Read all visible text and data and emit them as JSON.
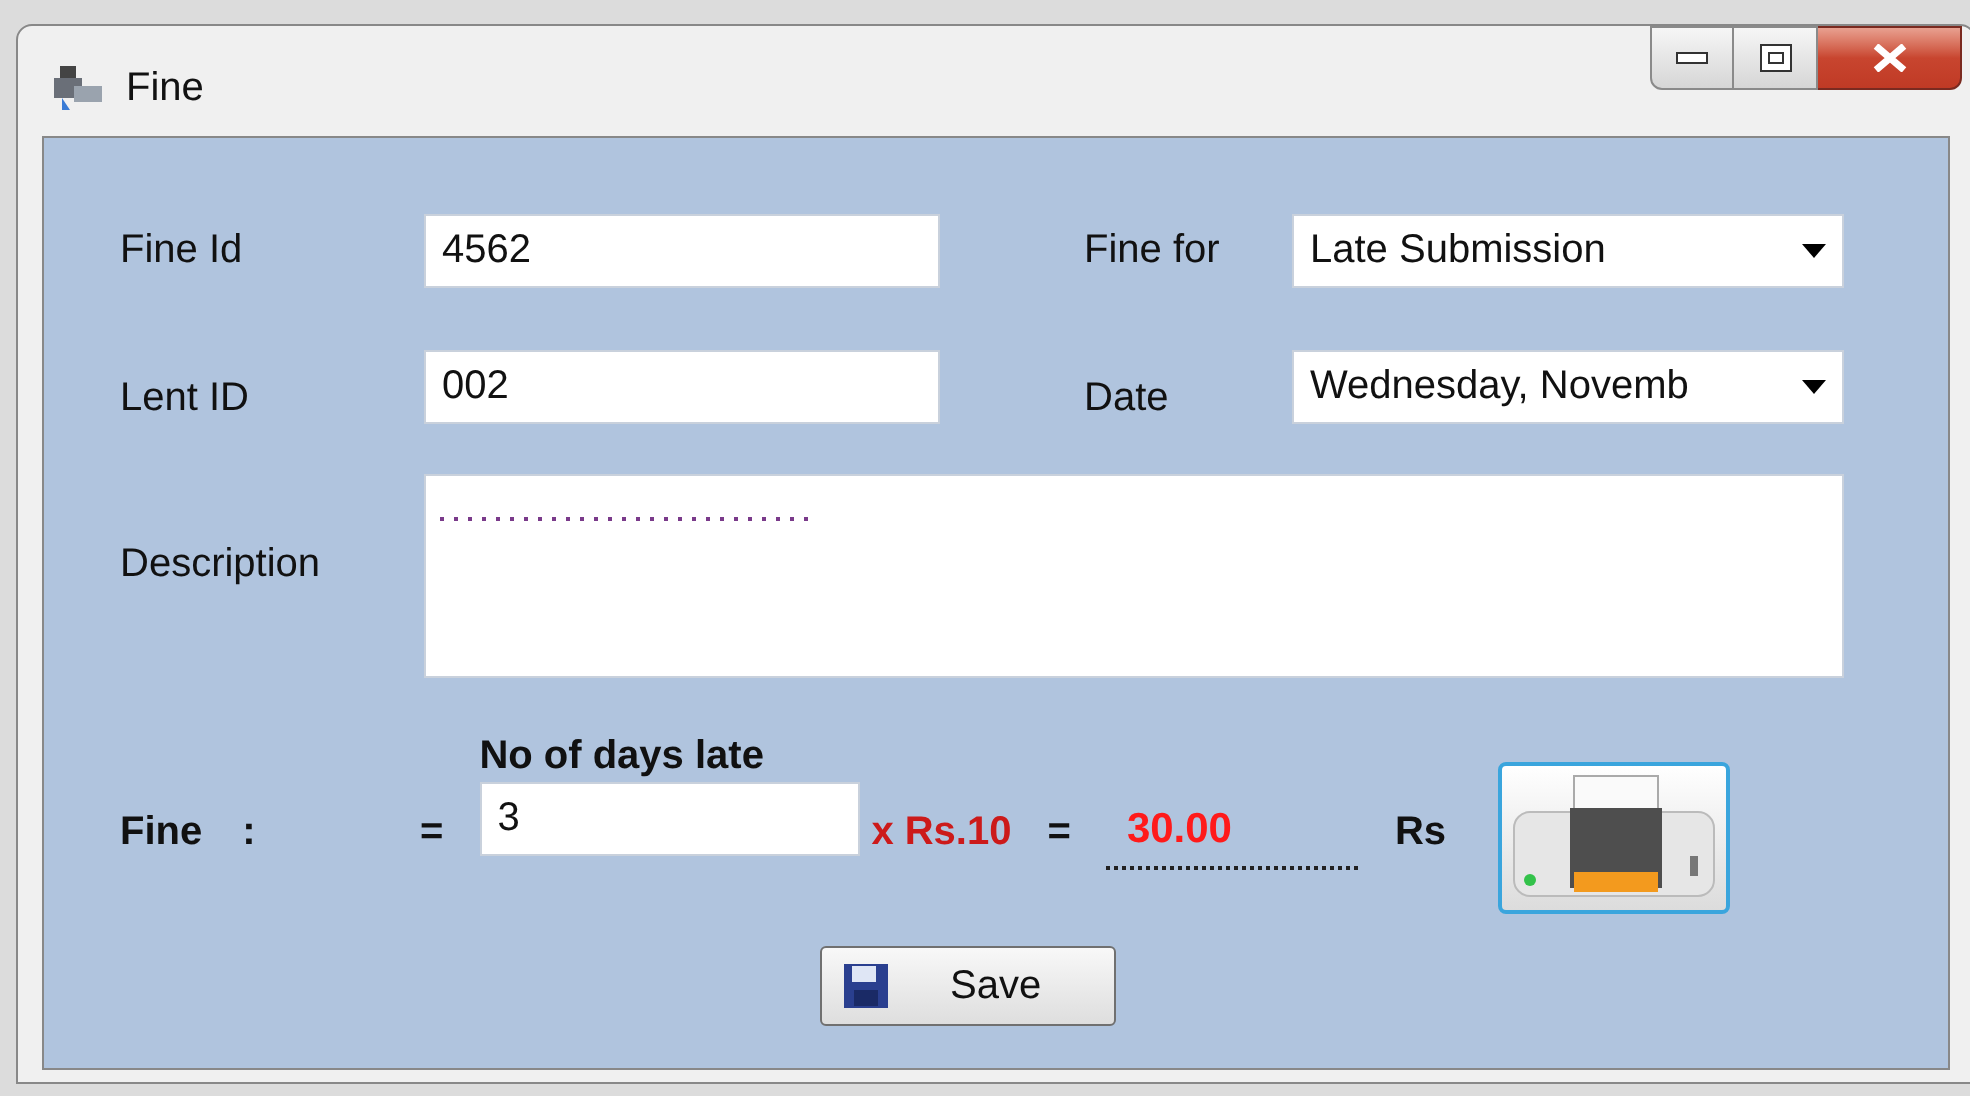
{
  "window": {
    "title": "Fine"
  },
  "fields": {
    "fine_id": {
      "label": "Fine Id",
      "value": "4562"
    },
    "lent_id": {
      "label": "Lent ID",
      "value": "002"
    },
    "fine_for": {
      "label": "Fine for",
      "value": "Late Submission"
    },
    "date": {
      "label": "Date",
      "value": "Wednesday, Novemb"
    },
    "description": {
      "label": "Description"
    }
  },
  "fine": {
    "label": "Fine",
    "colon": ":",
    "equals": "=",
    "days_label": "No of days late",
    "days_value": "3",
    "rate": "x Rs.10",
    "equals_2": "=",
    "total": "30.00",
    "currency": "Rs"
  },
  "buttons": [
    {
      "label": "Save"
    }
  ]
}
